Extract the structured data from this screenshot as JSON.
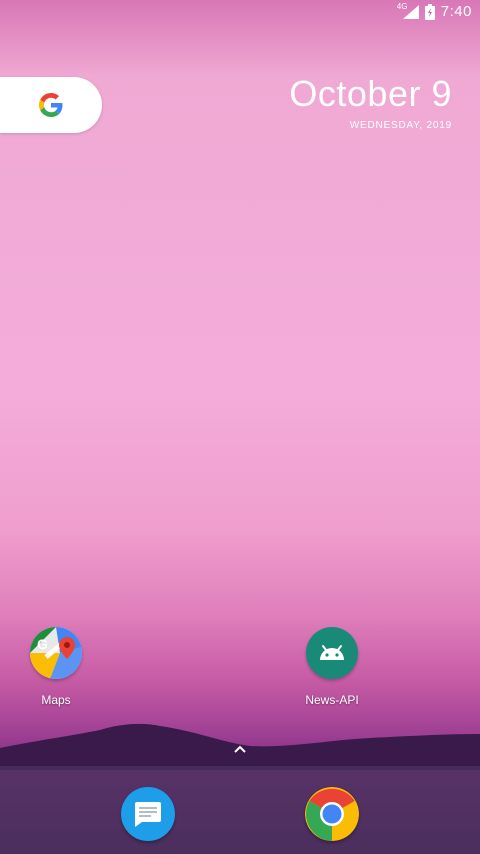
{
  "status_bar": {
    "network_label": "4G",
    "time": "7:40"
  },
  "search_widget": {
    "icon": "google-g-icon"
  },
  "date_widget": {
    "date": "October 9",
    "weekday_year": "WEDNESDAY, 2019"
  },
  "home_apps": [
    {
      "label": "Maps",
      "icon": "google-maps-icon"
    },
    {
      "label": "News-API",
      "icon": "android-icon"
    }
  ],
  "dock": {
    "apps": [
      {
        "icon": "messages-icon",
        "color": "#1e9ee8"
      },
      {
        "icon": "chrome-icon"
      }
    ]
  },
  "colors": {
    "google_blue": "#4285F4",
    "google_red": "#EA4335",
    "google_yellow": "#FBBC05",
    "google_green": "#34A853",
    "android_teal": "#1a8a78"
  }
}
